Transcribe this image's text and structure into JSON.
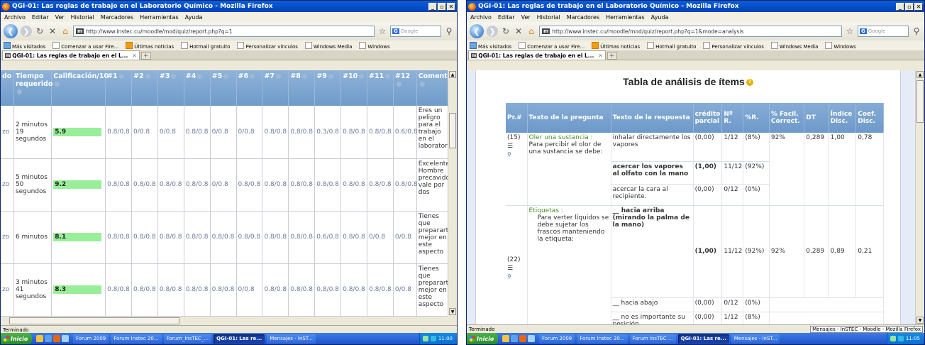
{
  "common": {
    "menu": [
      "Archivo",
      "Editar",
      "Ver",
      "Historial",
      "Marcadores",
      "Herramientas",
      "Ayuda"
    ],
    "bookmarks": [
      "Más visitados",
      "Comenzar a usar Fire...",
      "Últimas noticias",
      "Hotmail gratuito",
      "Personalizar vínculos",
      "Windows Media",
      "Windows"
    ],
    "search_placeholder": "Google",
    "status": "Terminado",
    "start": "Inicio"
  },
  "w1": {
    "title": "QGI-01: Las reglas de trabajo en el Laboratorio Químico - Mozilla Firefox",
    "url": "http://www.instec.cu/moodle/mod/quiz/report.php?q=1",
    "tab": "QGI-01: Las reglas de trabajo en el L...",
    "headers": [
      "do",
      "Tiempo requerido",
      "Calificación/10",
      "#1",
      "#2",
      "#3",
      "#4",
      "#5",
      "#6",
      "#7",
      "#8",
      "#9",
      "#10",
      "#11",
      "#12",
      "Comentario"
    ],
    "rows": [
      {
        "c0": "zo",
        "time": "2 minutos 19 segundos",
        "grade": "5.9",
        "q": [
          "0.8/0.8",
          "0/0.8",
          "0/0.8",
          "0.8/0.8",
          "0/0.8",
          "0/0.8",
          "0.8/0.8",
          "0.8/0.8",
          "0.3/0.8",
          "0.8/0.8",
          "0.8/0.8",
          "0.6/0.8"
        ],
        "comment": "Eres un peligro para el trabajo en el laboratorio"
      },
      {
        "c0": "zo",
        "time": "5 minutos 50 segundos",
        "grade": "9.2",
        "q": [
          "0.8/0.8",
          "0.8/0.8",
          "0.8/0.8",
          "0.8/0.8",
          "0/0.8",
          "0.8/0.8",
          "0.8/0.8",
          "0.8/0.8",
          "0.8/0.8",
          "0.8/0.8",
          "0.8/0.8",
          "0.8/0.8"
        ],
        "comment": "Excelente. Hombre precavido vale por dos"
      },
      {
        "c0": "zo",
        "time": "6 minutos",
        "grade": "8.1",
        "q": [
          "0.8/0.8",
          "0.8/0.8",
          "0.8/0.8",
          "0.8/0.8",
          "0.8/0.8",
          "0.8/0.8",
          "0.8/0.8",
          "0.8/0.8",
          "0.6/0.8",
          "0.8/0.8",
          "0/0.8",
          "0/0.8"
        ],
        "comment": "Tienes que prepararte mejor en este aspecto"
      },
      {
        "c0": "zo",
        "time": "3 minutos 41 segundos",
        "grade": "8.3",
        "q": [
          "0.8/0.8",
          "0.8/0.8",
          "0.8/0.8",
          "0.8/0.8",
          "0.8/0.8",
          "0/0.8",
          "0.8/0.8",
          "0.8/0.8",
          "0.8/0.8",
          "0.8/0.8",
          "0.8/0.8",
          "0/0.8"
        ],
        "comment": "Tienes que prepararte mejor en este aspecto"
      }
    ],
    "taskbar": [
      "Forum 2009",
      "Forum Instec 20...",
      "Forum_InsTEC_...",
      "QGI-01: Las re...",
      "Mensajes - InST..."
    ],
    "clock": "11:00"
  },
  "w2": {
    "title": "QGI-01: Las reglas de trabajo en el Laboratorio Químico - Mozilla Firefox",
    "url": "http://www.instec.cu/moodle/mod/quiz/report.php?q=1&mode=analysis",
    "tab": "QGI-01: Las reglas de trabajo en el L...",
    "heading": "Tabla de análisis de ítems",
    "headers": [
      "Pr.#",
      "Texto de la pregunta",
      "Texto de la respuesta",
      "crédito parcial",
      "Nº R.",
      "%R.",
      "% Facil. Correct.",
      "DT",
      "Índice Disc.",
      "Coef. Disc."
    ],
    "q1": {
      "num": "(15)",
      "title": "Oler una sustancia :",
      "text": "Para percibir el olor de una sustancia se debe:",
      "facil": "92%",
      "dt": "0,289",
      "idx": "1,00",
      "coef": "0,78"
    },
    "q1_answers": [
      {
        "text": "inhalar directamente los vapores",
        "credit": "(0,00)",
        "n": "1/12",
        "pct": "(8%)"
      },
      {
        "text": "acercar los vapores al olfato con la mano",
        "credit": "(1,00)",
        "n": "11/12",
        "pct": "(92%)"
      },
      {
        "text": "acercar la cara al recipiente.",
        "credit": "(0,00)",
        "n": "0/12",
        "pct": "(0%)"
      }
    ],
    "q2": {
      "num": "(22)",
      "title": "Etiquetas :",
      "text": "Para verter líquidos se debe sujetar los frascos manteniendo la etiqueta:",
      "facil": "92%",
      "dt": "0,289",
      "idx": "0,89",
      "coef": "0,21"
    },
    "q2_answers": [
      {
        "text": "__ hacia arriba (mirando la palma de la mano)",
        "credit": "(1,00)",
        "n": "11/12",
        "pct": "(92%)"
      },
      {
        "text": "__ hacia abajo",
        "credit": "(0,00)",
        "n": "0/12",
        "pct": "(0%)"
      },
      {
        "text": "__ no es importante su posición",
        "credit": "(0,00)",
        "n": "1/12",
        "pct": "(8%)"
      }
    ],
    "status_right": "Mensajes - InSTEC - Moodle - Mozilla Firefox",
    "taskbar": [
      "Forum 2009",
      "Forum Instec 20...",
      "Forum InsTEC ...",
      "QGI-01: Las re...",
      "Mensajes - InST..."
    ],
    "clock": "11:05"
  }
}
